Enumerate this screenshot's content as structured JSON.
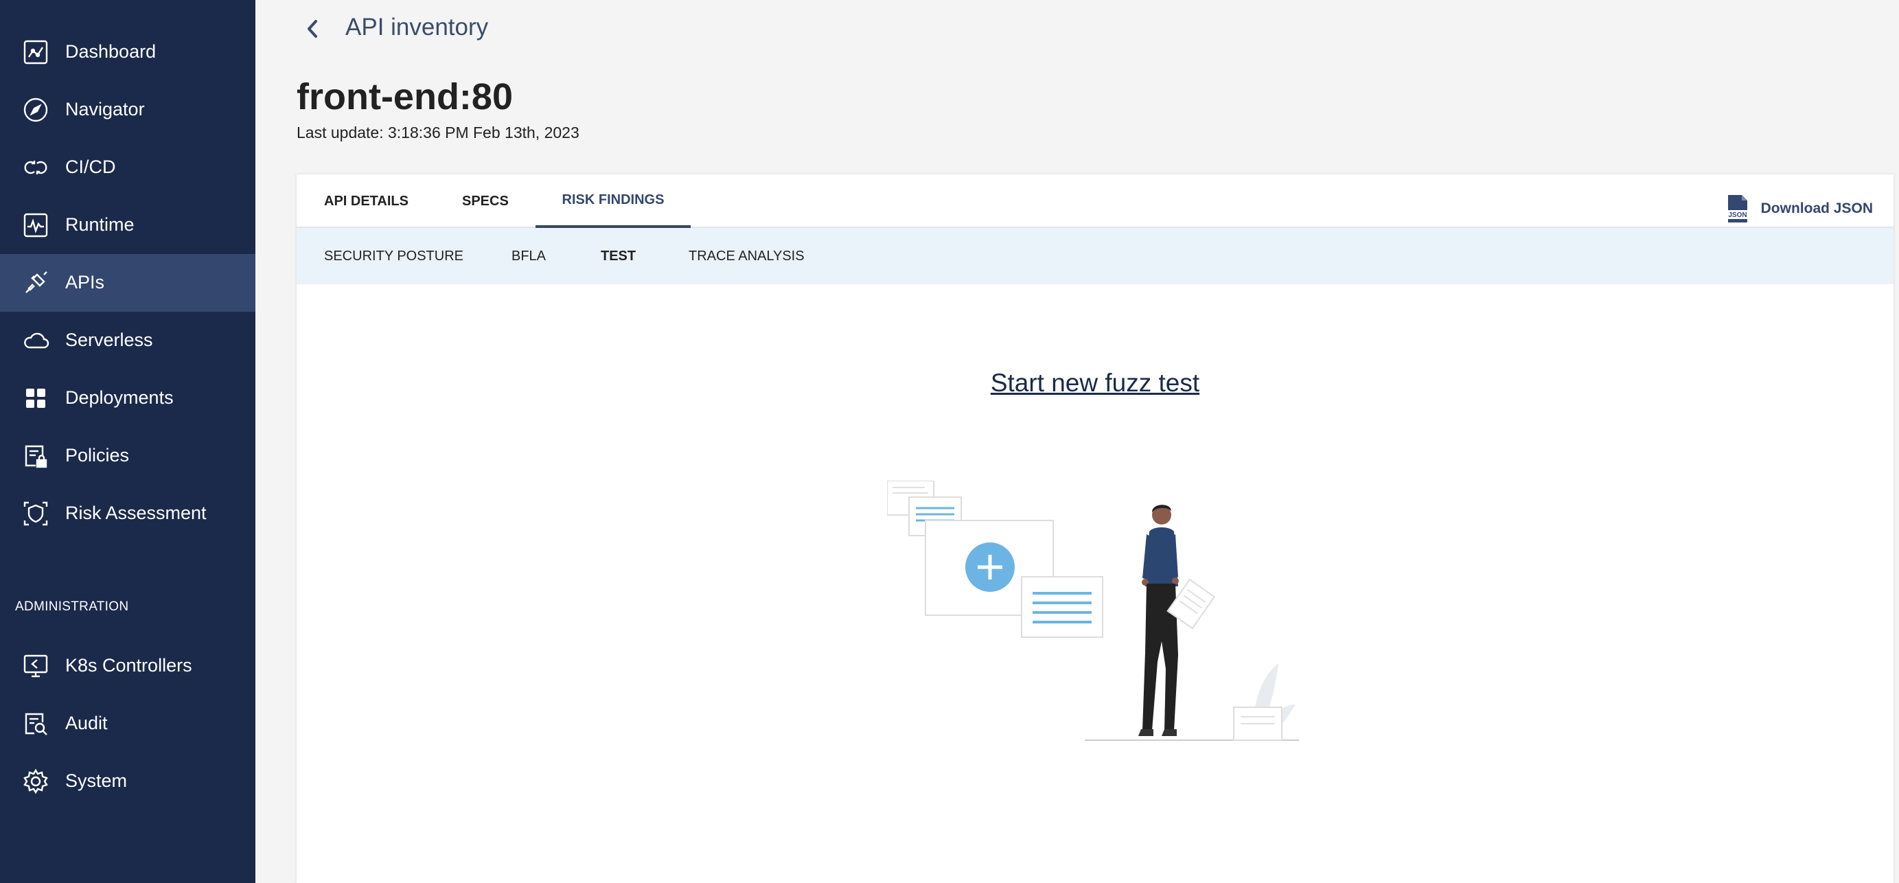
{
  "sidebar": {
    "items": [
      {
        "label": "Dashboard",
        "icon": "dashboard-icon"
      },
      {
        "label": "Navigator",
        "icon": "compass-icon"
      },
      {
        "label": "CI/CD",
        "icon": "cicd-icon"
      },
      {
        "label": "Runtime",
        "icon": "runtime-icon"
      },
      {
        "label": "APIs",
        "icon": "api-icon",
        "active": true
      },
      {
        "label": "Serverless",
        "icon": "cloud-icon"
      },
      {
        "label": "Deployments",
        "icon": "grid-icon"
      },
      {
        "label": "Policies",
        "icon": "policy-lock-icon"
      },
      {
        "label": "Risk Assessment",
        "icon": "risk-shield-icon"
      }
    ],
    "section_label": "ADMINISTRATION",
    "admin_items": [
      {
        "label": "K8s Controllers",
        "icon": "k8s-monitor-icon"
      },
      {
        "label": "Audit",
        "icon": "audit-icon"
      },
      {
        "label": "System",
        "icon": "gear-icon"
      }
    ]
  },
  "header": {
    "breadcrumb": "API inventory",
    "title": "front-end:80",
    "last_update": "Last update: 3:18:36 PM Feb 13th, 2023"
  },
  "tabs": [
    {
      "label": "API DETAILS"
    },
    {
      "label": "SPECS"
    },
    {
      "label": "RISK FINDINGS",
      "active": true
    }
  ],
  "download_label": "Download JSON",
  "download_icon_text": "JSON",
  "subtabs": [
    {
      "label": "SECURITY POSTURE"
    },
    {
      "label": "BFLA"
    },
    {
      "label": "TEST",
      "active": true
    },
    {
      "label": "TRACE ANALYSIS"
    }
  ],
  "main": {
    "fuzz_link": "Start new fuzz test"
  },
  "colors": {
    "sidebar_bg": "#1b2a4a",
    "sidebar_active": "#34476e",
    "accent": "#34476e",
    "subtab_bg": "#eaf2fa",
    "illustration_blue": "#6cb4e4"
  }
}
